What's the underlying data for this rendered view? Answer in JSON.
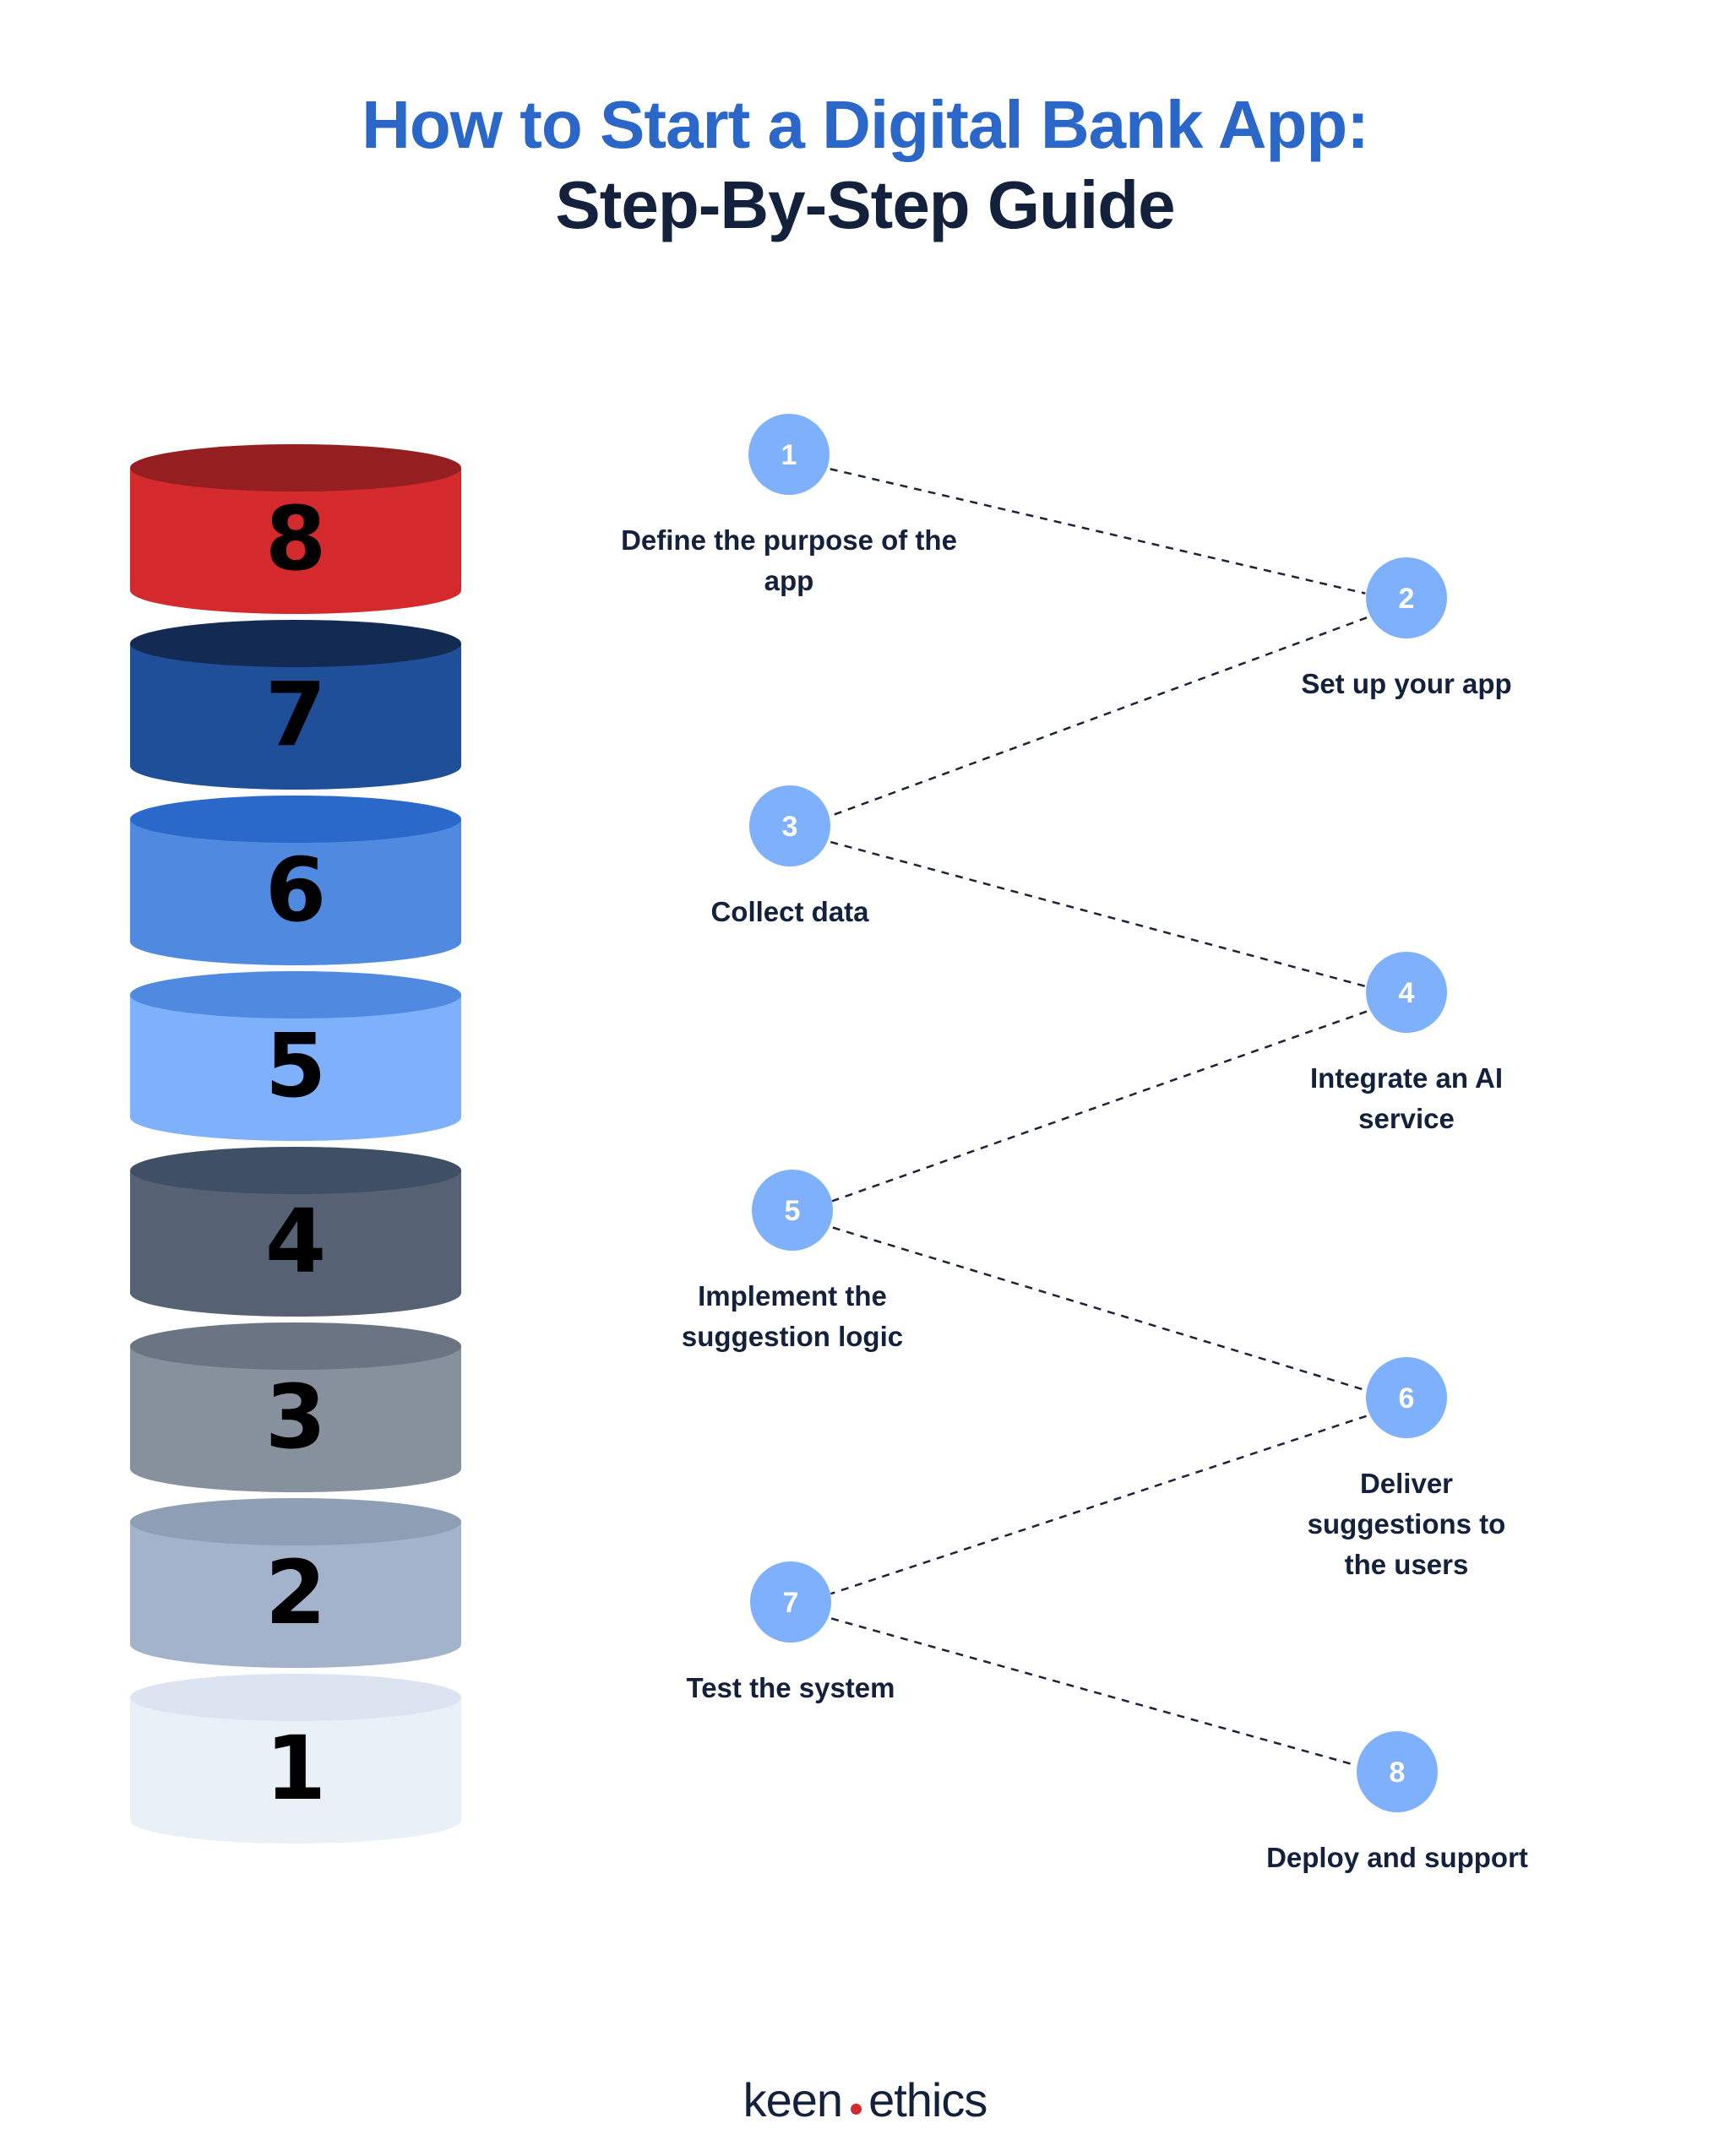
{
  "header": {
    "title_line1": "How to Start a Digital Bank App:",
    "title_line2": "Step-By-Step Guide"
  },
  "colors": {
    "title_accent": "#2a67c9",
    "text_dark": "#13213d",
    "step_circle": "#7eb0fb",
    "dash_line": "#1a2438",
    "logo_dot": "#d42a2d"
  },
  "stack": [
    {
      "number": "8",
      "top_color": "#951f20",
      "body_color": "#d42a2d"
    },
    {
      "number": "7",
      "top_color": "#132b52",
      "body_color": "#1f4f98"
    },
    {
      "number": "6",
      "top_color": "#2a68c9",
      "body_color": "#4f8ae0"
    },
    {
      "number": "5",
      "top_color": "#4f8ae0",
      "body_color": "#7eb0fb"
    },
    {
      "number": "4",
      "top_color": "#3f4f66",
      "body_color": "#566273"
    },
    {
      "number": "3",
      "top_color": "#6b7482",
      "body_color": "#87909d"
    },
    {
      "number": "2",
      "top_color": "#8e9eb5",
      "body_color": "#a3b3cb"
    },
    {
      "number": "1",
      "top_color": "#dbe4f0",
      "body_color": "#eaf0f8"
    }
  ],
  "steps": [
    {
      "number": "1",
      "label_lines": [
        "Define the purpose of the",
        "app"
      ],
      "side": "left"
    },
    {
      "number": "2",
      "label_lines": [
        "Set up your app"
      ],
      "side": "right"
    },
    {
      "number": "3",
      "label_lines": [
        "Collect data"
      ],
      "side": "left"
    },
    {
      "number": "4",
      "label_lines": [
        "Integrate an AI",
        "service"
      ],
      "side": "right"
    },
    {
      "number": "5",
      "label_lines": [
        "Implement the",
        "suggestion logic"
      ],
      "side": "left"
    },
    {
      "number": "6",
      "label_lines": [
        "Deliver",
        "suggestions to",
        "the users"
      ],
      "side": "right"
    },
    {
      "number": "7",
      "label_lines": [
        "Test the system"
      ],
      "side": "left"
    },
    {
      "number": "8",
      "label_lines": [
        "Deploy and support"
      ],
      "side": "right"
    }
  ],
  "footer": {
    "logo_left": "keen",
    "logo_right": "ethics"
  }
}
